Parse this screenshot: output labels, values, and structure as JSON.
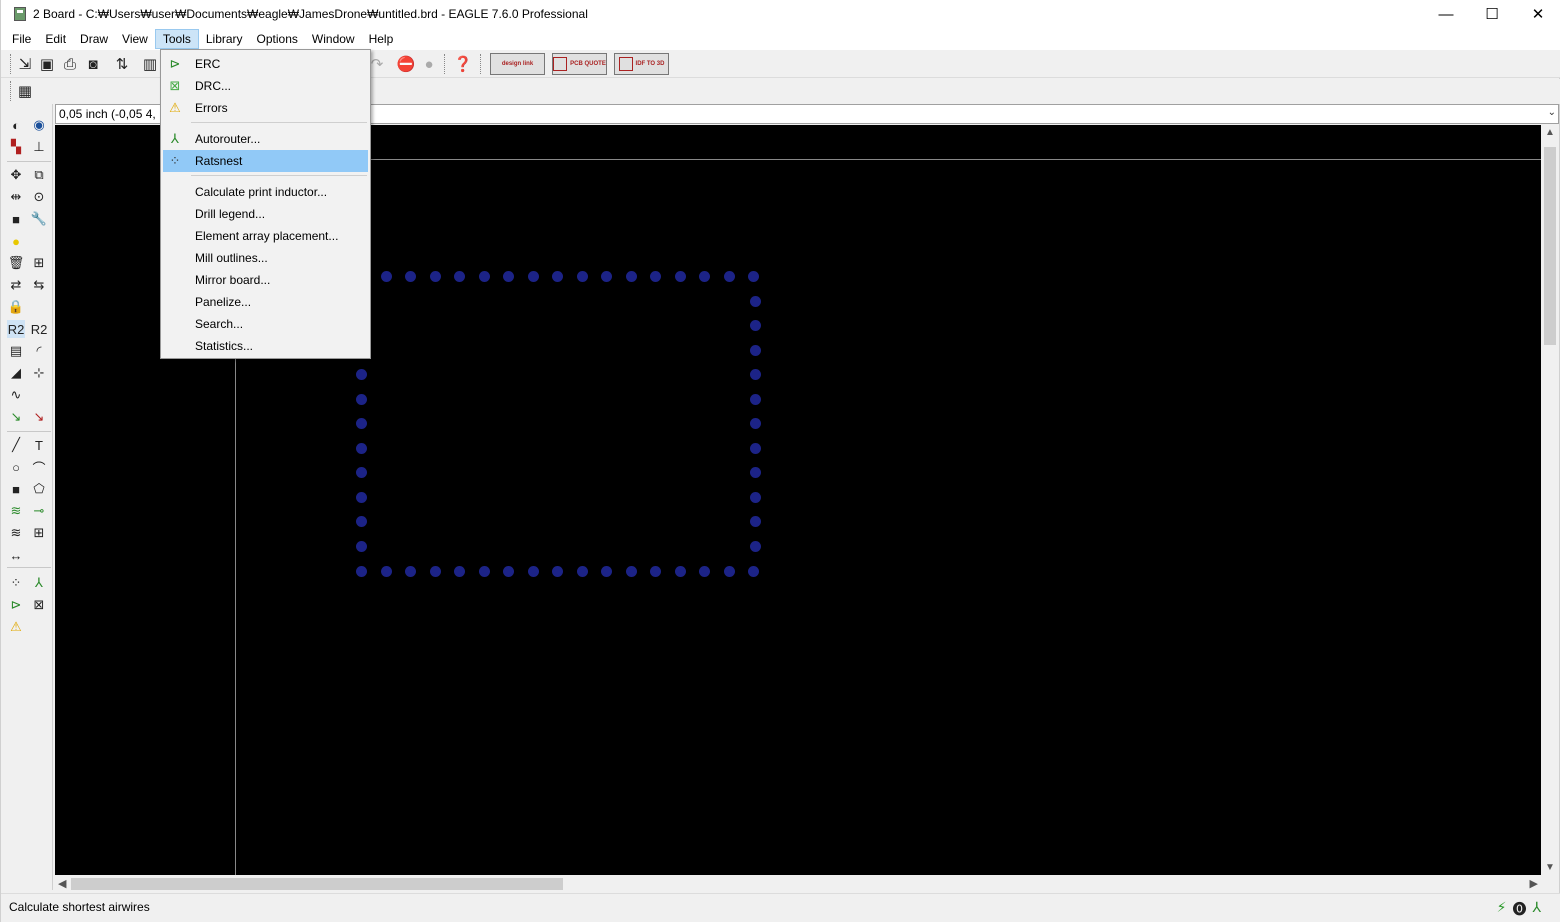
{
  "window": {
    "title": "2 Board - C:₩Users₩user₩Documents₩eagle₩JamesDrone₩untitled.brd - EAGLE 7.6.0 Professional",
    "controls": {
      "minimize": "—",
      "maximize": "☐",
      "close": "✕"
    }
  },
  "menubar": {
    "items": [
      "File",
      "Edit",
      "Draw",
      "View",
      "Tools",
      "Library",
      "Options",
      "Window",
      "Help"
    ],
    "active": "Tools"
  },
  "toolbar": {
    "design_link_label": "design link",
    "pcb_quote_label": "PCB QUOTE",
    "idf_label": "IDF TO 3D"
  },
  "coordinates": {
    "value": "0,05 inch (-0,05 4,"
  },
  "tools_menu": {
    "items": [
      {
        "label": "ERC",
        "icon": "erc-icon"
      },
      {
        "label": "DRC...",
        "icon": "drc-icon"
      },
      {
        "label": "Errors",
        "icon": "warning-icon"
      },
      {
        "label": "Autorouter...",
        "icon": "autorouter-icon"
      },
      {
        "label": "Ratsnest",
        "icon": "ratsnest-icon",
        "highlighted": true
      },
      {
        "label": "Calculate print inductor..."
      },
      {
        "label": "Drill legend..."
      },
      {
        "label": "Element array placement..."
      },
      {
        "label": "Mill outlines..."
      },
      {
        "label": "Mirror board..."
      },
      {
        "label": "Panelize..."
      },
      {
        "label": "Search..."
      },
      {
        "label": "Statistics..."
      }
    ]
  },
  "status": {
    "text": "Calculate shortest airwires"
  },
  "colors": {
    "pad": "#1c2387",
    "canvas": "#000000",
    "menu_highlight": "#91c9f7"
  }
}
